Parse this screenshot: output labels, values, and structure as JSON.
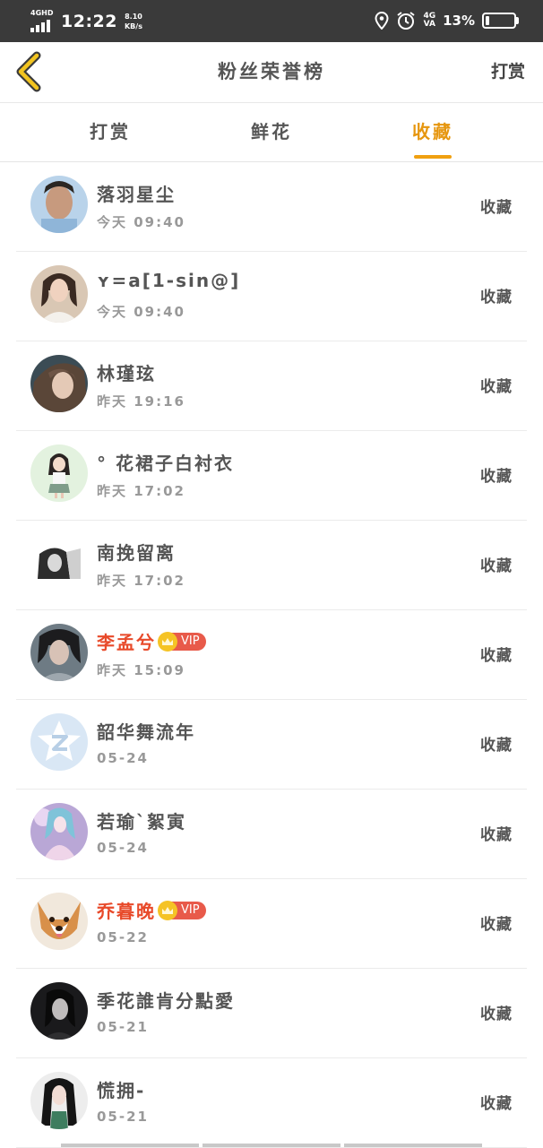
{
  "status_bar": {
    "network_type": "4GHD",
    "time": "12:22",
    "speed_value": "8.10",
    "speed_unit": "KB/s",
    "net_right_top": "4G",
    "net_right_bottom": "VA",
    "battery_percent": "13%",
    "battery_level": 0.13
  },
  "header": {
    "title": "粉丝荣誉榜",
    "right_action": "打赏"
  },
  "tabs": [
    {
      "label": "打赏",
      "active": false
    },
    {
      "label": "鲜花",
      "active": false
    },
    {
      "label": "收藏",
      "active": true
    }
  ],
  "rows": [
    {
      "name": "落羽星尘",
      "time": "今天 09:40",
      "action": "收藏",
      "vip": false
    },
    {
      "name": "ʏ=a[1-sin@]",
      "time": "今天 09:40",
      "action": "收藏",
      "vip": false
    },
    {
      "name": "林瑾玹",
      "time": "昨天 19:16",
      "action": "收藏",
      "vip": false
    },
    {
      "name": "° 花裙子白衬衣",
      "time": "昨天 17:02",
      "action": "收藏",
      "vip": false
    },
    {
      "name": "南挽留离",
      "time": "昨天 17:02",
      "action": "收藏",
      "vip": false
    },
    {
      "name": "李孟兮",
      "time": "昨天 15:09",
      "action": "收藏",
      "vip": true,
      "vip_label": "VIP"
    },
    {
      "name": "韶华舞流年",
      "time": "05-24",
      "action": "收藏",
      "vip": false
    },
    {
      "name": "若瑜`絮寅",
      "time": "05-24",
      "action": "收藏",
      "vip": false
    },
    {
      "name": "乔暮晚",
      "time": "05-22",
      "action": "收藏",
      "vip": true,
      "vip_label": "VIP"
    },
    {
      "name": "季花誰肯分點愛",
      "time": "05-21",
      "action": "收藏",
      "vip": false
    },
    {
      "name": "慌拥-",
      "time": "05-21",
      "action": "收藏",
      "vip": false
    }
  ],
  "colors": {
    "accent": "#e6960f",
    "vip_name": "#e84a2a",
    "status_bar": "#3a3a3a"
  }
}
